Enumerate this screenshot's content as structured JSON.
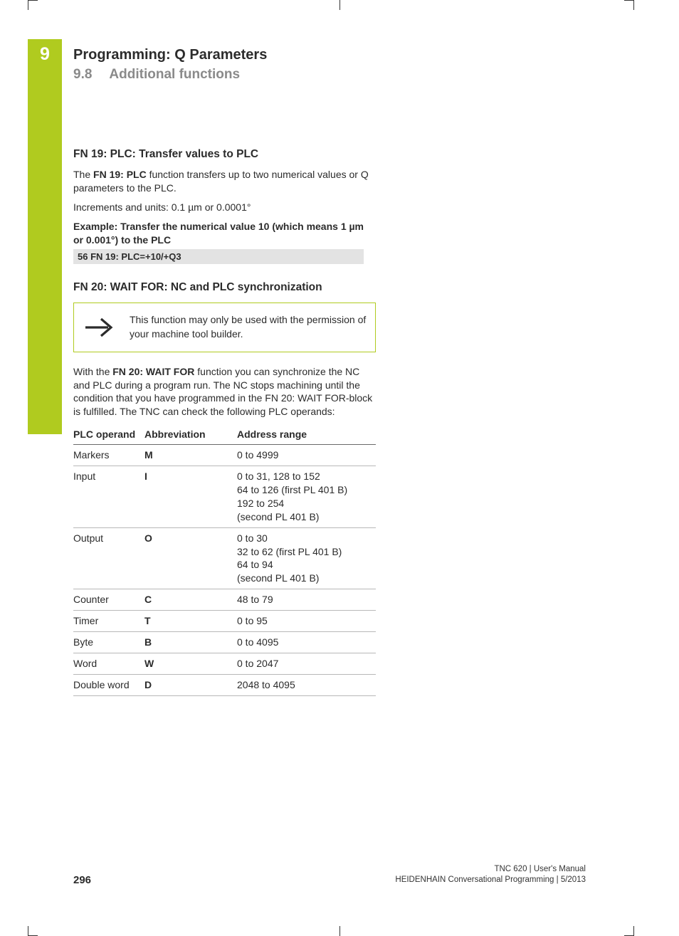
{
  "chapter": {
    "number": "9",
    "title": "Programming: Q Parameters",
    "section_number": "9.8",
    "section_title": "Additional functions"
  },
  "fn19": {
    "heading": "FN 19: PLC: Transfer values to PLC",
    "intro_pre": "The ",
    "intro_bold": "FN 19: PLC",
    "intro_post": " function transfers up to two numerical values or Q parameters to the PLC.",
    "increments": "Increments and units: 0.1 µm or 0.0001°",
    "example_label": "Example: Transfer the numerical value 10 (which means 1 µm or 0.001°) to the PLC",
    "code": "56 FN 19: PLC=+10/+Q3"
  },
  "fn20": {
    "heading": "FN 20: WAIT FOR: NC and PLC synchronization",
    "note": "This function may only be used with the permission of your machine tool builder.",
    "desc_pre": "With the ",
    "desc_bold": "FN 20: WAIT FOR",
    "desc_post": " function you can synchronize the NC and PLC during a program run. The NC stops machining until the condition that you have programmed in the FN 20: WAIT FOR-block is fulfilled. The TNC can check the following PLC operands:"
  },
  "table": {
    "headers": {
      "c1": "PLC operand",
      "c2": "Abbreviation",
      "c3": "Address range"
    },
    "rows": [
      {
        "op": "Markers",
        "ab": "M",
        "rg": "0 to 4999"
      },
      {
        "op": "Input",
        "ab": "I",
        "rg": "0 to 31, 128 to 152\n64 to 126 (first PL 401 B)\n192 to 254\n(second PL 401 B)"
      },
      {
        "op": "Output",
        "ab": "O",
        "rg": "0 to 30\n32 to 62 (first PL 401 B)\n64 to 94\n(second PL 401 B)"
      },
      {
        "op": "Counter",
        "ab": "C",
        "rg": "48 to 79"
      },
      {
        "op": "Timer",
        "ab": "T",
        "rg": "0 to 95"
      },
      {
        "op": "Byte",
        "ab": "B",
        "rg": "0 to 4095"
      },
      {
        "op": "Word",
        "ab": "W",
        "rg": "0 to 2047"
      },
      {
        "op": "Double word",
        "ab": "D",
        "rg": "2048 to 4095"
      }
    ]
  },
  "footer": {
    "page": "296",
    "line1": "TNC 620 | User's Manual",
    "line2": "HEIDENHAIN Conversational Programming | 5/2013"
  }
}
